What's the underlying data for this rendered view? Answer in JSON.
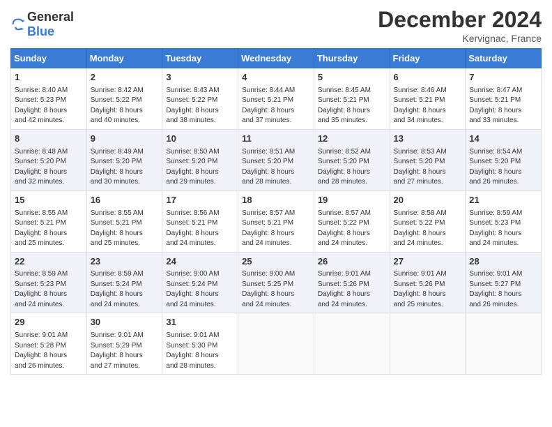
{
  "header": {
    "logo_general": "General",
    "logo_blue": "Blue",
    "title": "December 2024",
    "location": "Kervignac, France"
  },
  "days_of_week": [
    "Sunday",
    "Monday",
    "Tuesday",
    "Wednesday",
    "Thursday",
    "Friday",
    "Saturday"
  ],
  "weeks": [
    [
      {
        "day": "1",
        "lines": [
          "Sunrise: 8:40 AM",
          "Sunset: 5:23 PM",
          "Daylight: 8 hours",
          "and 42 minutes."
        ]
      },
      {
        "day": "2",
        "lines": [
          "Sunrise: 8:42 AM",
          "Sunset: 5:22 PM",
          "Daylight: 8 hours",
          "and 40 minutes."
        ]
      },
      {
        "day": "3",
        "lines": [
          "Sunrise: 8:43 AM",
          "Sunset: 5:22 PM",
          "Daylight: 8 hours",
          "and 38 minutes."
        ]
      },
      {
        "day": "4",
        "lines": [
          "Sunrise: 8:44 AM",
          "Sunset: 5:21 PM",
          "Daylight: 8 hours",
          "and 37 minutes."
        ]
      },
      {
        "day": "5",
        "lines": [
          "Sunrise: 8:45 AM",
          "Sunset: 5:21 PM",
          "Daylight: 8 hours",
          "and 35 minutes."
        ]
      },
      {
        "day": "6",
        "lines": [
          "Sunrise: 8:46 AM",
          "Sunset: 5:21 PM",
          "Daylight: 8 hours",
          "and 34 minutes."
        ]
      },
      {
        "day": "7",
        "lines": [
          "Sunrise: 8:47 AM",
          "Sunset: 5:21 PM",
          "Daylight: 8 hours",
          "and 33 minutes."
        ]
      }
    ],
    [
      {
        "day": "8",
        "lines": [
          "Sunrise: 8:48 AM",
          "Sunset: 5:20 PM",
          "Daylight: 8 hours",
          "and 32 minutes."
        ]
      },
      {
        "day": "9",
        "lines": [
          "Sunrise: 8:49 AM",
          "Sunset: 5:20 PM",
          "Daylight: 8 hours",
          "and 30 minutes."
        ]
      },
      {
        "day": "10",
        "lines": [
          "Sunrise: 8:50 AM",
          "Sunset: 5:20 PM",
          "Daylight: 8 hours",
          "and 29 minutes."
        ]
      },
      {
        "day": "11",
        "lines": [
          "Sunrise: 8:51 AM",
          "Sunset: 5:20 PM",
          "Daylight: 8 hours",
          "and 28 minutes."
        ]
      },
      {
        "day": "12",
        "lines": [
          "Sunrise: 8:52 AM",
          "Sunset: 5:20 PM",
          "Daylight: 8 hours",
          "and 28 minutes."
        ]
      },
      {
        "day": "13",
        "lines": [
          "Sunrise: 8:53 AM",
          "Sunset: 5:20 PM",
          "Daylight: 8 hours",
          "and 27 minutes."
        ]
      },
      {
        "day": "14",
        "lines": [
          "Sunrise: 8:54 AM",
          "Sunset: 5:20 PM",
          "Daylight: 8 hours",
          "and 26 minutes."
        ]
      }
    ],
    [
      {
        "day": "15",
        "lines": [
          "Sunrise: 8:55 AM",
          "Sunset: 5:21 PM",
          "Daylight: 8 hours",
          "and 25 minutes."
        ]
      },
      {
        "day": "16",
        "lines": [
          "Sunrise: 8:55 AM",
          "Sunset: 5:21 PM",
          "Daylight: 8 hours",
          "and 25 minutes."
        ]
      },
      {
        "day": "17",
        "lines": [
          "Sunrise: 8:56 AM",
          "Sunset: 5:21 PM",
          "Daylight: 8 hours",
          "and 24 minutes."
        ]
      },
      {
        "day": "18",
        "lines": [
          "Sunrise: 8:57 AM",
          "Sunset: 5:21 PM",
          "Daylight: 8 hours",
          "and 24 minutes."
        ]
      },
      {
        "day": "19",
        "lines": [
          "Sunrise: 8:57 AM",
          "Sunset: 5:22 PM",
          "Daylight: 8 hours",
          "and 24 minutes."
        ]
      },
      {
        "day": "20",
        "lines": [
          "Sunrise: 8:58 AM",
          "Sunset: 5:22 PM",
          "Daylight: 8 hours",
          "and 24 minutes."
        ]
      },
      {
        "day": "21",
        "lines": [
          "Sunrise: 8:59 AM",
          "Sunset: 5:23 PM",
          "Daylight: 8 hours",
          "and 24 minutes."
        ]
      }
    ],
    [
      {
        "day": "22",
        "lines": [
          "Sunrise: 8:59 AM",
          "Sunset: 5:23 PM",
          "Daylight: 8 hours",
          "and 24 minutes."
        ]
      },
      {
        "day": "23",
        "lines": [
          "Sunrise: 8:59 AM",
          "Sunset: 5:24 PM",
          "Daylight: 8 hours",
          "and 24 minutes."
        ]
      },
      {
        "day": "24",
        "lines": [
          "Sunrise: 9:00 AM",
          "Sunset: 5:24 PM",
          "Daylight: 8 hours",
          "and 24 minutes."
        ]
      },
      {
        "day": "25",
        "lines": [
          "Sunrise: 9:00 AM",
          "Sunset: 5:25 PM",
          "Daylight: 8 hours",
          "and 24 minutes."
        ]
      },
      {
        "day": "26",
        "lines": [
          "Sunrise: 9:01 AM",
          "Sunset: 5:26 PM",
          "Daylight: 8 hours",
          "and 24 minutes."
        ]
      },
      {
        "day": "27",
        "lines": [
          "Sunrise: 9:01 AM",
          "Sunset: 5:26 PM",
          "Daylight: 8 hours",
          "and 25 minutes."
        ]
      },
      {
        "day": "28",
        "lines": [
          "Sunrise: 9:01 AM",
          "Sunset: 5:27 PM",
          "Daylight: 8 hours",
          "and 26 minutes."
        ]
      }
    ],
    [
      {
        "day": "29",
        "lines": [
          "Sunrise: 9:01 AM",
          "Sunset: 5:28 PM",
          "Daylight: 8 hours",
          "and 26 minutes."
        ]
      },
      {
        "day": "30",
        "lines": [
          "Sunrise: 9:01 AM",
          "Sunset: 5:29 PM",
          "Daylight: 8 hours",
          "and 27 minutes."
        ]
      },
      {
        "day": "31",
        "lines": [
          "Sunrise: 9:01 AM",
          "Sunset: 5:30 PM",
          "Daylight: 8 hours",
          "and 28 minutes."
        ]
      },
      null,
      null,
      null,
      null
    ]
  ]
}
